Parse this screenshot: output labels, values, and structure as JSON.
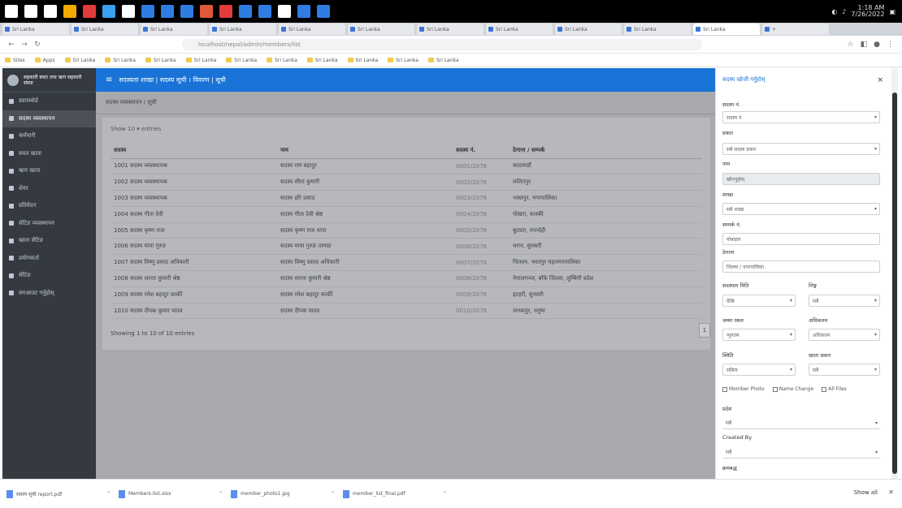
{
  "taskbar": {
    "icon_colors": [
      "#ffffff",
      "#ffffff",
      "#ffffff",
      "#f2a900",
      "#e23b3b",
      "#3aa0f0",
      "#ffffff",
      "#2f7de1",
      "#2f7de1",
      "#2f7de1",
      "#e0583b",
      "#e23b3b",
      "#2f7de1",
      "#2f7de1",
      "#ffffff",
      "#2f7de1",
      "#2f7de1"
    ],
    "time": "1:18 AM",
    "date": "7/26/2022"
  },
  "tabs": [
    {
      "label": "Sri Lanka"
    },
    {
      "label": "Sri Lanka"
    },
    {
      "label": "Sri Lanka"
    },
    {
      "label": "Sri Lanka"
    },
    {
      "label": "Sri Lanka"
    },
    {
      "label": "Sri Lanka"
    },
    {
      "label": "Sri Lanka"
    },
    {
      "label": "Sri Lanka"
    },
    {
      "label": "Sri Lanka"
    },
    {
      "label": "Sri Lanka"
    },
    {
      "label": "Sri Lanka",
      "active": true
    },
    {
      "label": "+"
    }
  ],
  "address": {
    "url": "localhost/nepal/admin/members/list"
  },
  "bookmarks": [
    "Sites",
    "Apps",
    "Sri Lanka",
    "Sri Lanka",
    "Sri Lanka",
    "Sri Lanka",
    "Sri Lanka",
    "Sri Lanka",
    "Sri Lanka",
    "Sri Lanka",
    "Sri Lanka",
    "Sri Lanka"
  ],
  "sidebar": {
    "brand": "सहकारी बचत तथा ऋण सहकारी संस्था",
    "items": [
      {
        "label": "ड्यासबोर्ड"
      },
      {
        "label": "सदस्य व्यवस्थापन",
        "active": true
      },
      {
        "label": "कर्मचारी"
      },
      {
        "label": "बचत खाता"
      },
      {
        "label": "ऋण खाता"
      },
      {
        "label": "शेयर"
      },
      {
        "label": "प्रतिवेदन"
      },
      {
        "label": "सेटिङ व्यवस्थापन"
      },
      {
        "label": "खाता सेटिङ"
      },
      {
        "label": "प्रयोगकर्ता"
      },
      {
        "label": "सेटिङ"
      },
      {
        "label": "लगआउट गर्नुहोस्"
      }
    ]
  },
  "topbar": {
    "title": "सदस्यता शाखा  |  सदस्य सूची  ।  विवरण  |  सूची"
  },
  "breadcrumb": "सदस्य व्यवस्थापन  /  सूची",
  "table": {
    "show_text": "Show  10  ▾  entries",
    "headers": [
      "सदस्य",
      "नाम",
      "सदस्य नं.",
      "ठेगाना / सम्पर्क"
    ],
    "rows": [
      [
        "1001  सदस्य व्यवस्थापक",
        "सदस्य राम बहादुर",
        "0001/2078",
        "काठमाडौं"
      ],
      [
        "1002  सदस्य व्यवस्थापक",
        "सदस्य सीता कुमारी",
        "0002/2078",
        "ललितपुर"
      ],
      [
        "1003  सदस्य व्यवस्थापक",
        "सदस्य हरि प्रसाद",
        "0003/2078",
        "भक्तपुर, नगरपालिका"
      ],
      [
        "1004  सदस्य गीता देवी",
        "सदस्य गीता देवी श्रेष्ठ",
        "0004/2078",
        "पोखरा, कास्की"
      ],
      [
        "1005  सदस्य कृष्ण राज",
        "सदस्य कृष्ण राज थापा",
        "0005/2078",
        "बुटवल, रुपन्देही"
      ],
      [
        "1006  सदस्य माया गुरुङ",
        "सदस्य माया गुरुङ तामाङ",
        "0006/2078",
        "धरान, सुनसरी"
      ],
      [
        "1007  सदस्य विष्णु प्रसाद अधिकारी",
        "सदस्य विष्णु प्रसाद अधिकारी",
        "0007/2078",
        "चितवन, भरतपुर महानगरपालिका"
      ],
      [
        "1008  सदस्य शान्ता कुमारी श्रेष्ठ",
        "सदस्य शान्ता कुमारी श्रेष्ठ",
        "0008/2078",
        "नेपालगञ्ज, बाँके जिल्ला, लुम्बिनी प्रदेश"
      ],
      [
        "1009  सदस्य रमेश बहादुर कार्की",
        "सदस्य रमेश बहादुर कार्की",
        "0009/2078",
        "इटहरी, सुनसरी"
      ],
      [
        "1010  सदस्य दीपक कुमार यादव",
        "सदस्य दीपक यादव",
        "0010/2078",
        "जनकपुर, धनुषा"
      ]
    ],
    "footer": "Showing 1 to 10 of 10 entries",
    "page_btn": "1"
  },
  "panel": {
    "title": "सदस्य खोजी गर्नुहोस्",
    "close": "×",
    "f1": {
      "label": "सदस्य नं.",
      "placeholder": "सदस्य नं."
    },
    "f2": {
      "label": "प्रकार",
      "value": "सबै सदस्य प्रकार"
    },
    "f3": {
      "label": "नाम",
      "value": "खोज्नुहोस्"
    },
    "f4": {
      "label": "शाखा",
      "value": "सबै शाखा"
    },
    "f5": {
      "label": "सम्पर्क नं.",
      "value": "मोबाइल"
    },
    "f6": {
      "label": "ठेगाना",
      "value": "जिल्ला / नगरपालिका"
    },
    "f7a": {
      "label": "सदस्यता मिति",
      "value": "देखि"
    },
    "f7b": {
      "label": "लिङ्ग",
      "value": "सबै"
    },
    "f8a": {
      "label": "जम्मा रकम",
      "value": "न्यूनतम"
    },
    "f8b": {
      "label": "अधिकतम",
      "value": "अधिकतम"
    },
    "f9a": {
      "label": "स्थिति",
      "value": "सक्रिय"
    },
    "f9b": {
      "label": "खाता प्रकार",
      "value": "सबै"
    },
    "checks": [
      "Member Photo",
      "Name Change",
      "All Files"
    ],
    "f10": {
      "label": "प्रदेश",
      "value": "सबै"
    },
    "f11": {
      "label": "Created By",
      "value": "सबै"
    },
    "f12": {
      "label": "क्रमबद्ध"
    }
  },
  "downloads": [
    "सदस्य सूची report.pdf",
    "Members-list.xlsx",
    "member_photo1.jpg",
    "member_list_final.pdf"
  ],
  "showall": "Show all"
}
